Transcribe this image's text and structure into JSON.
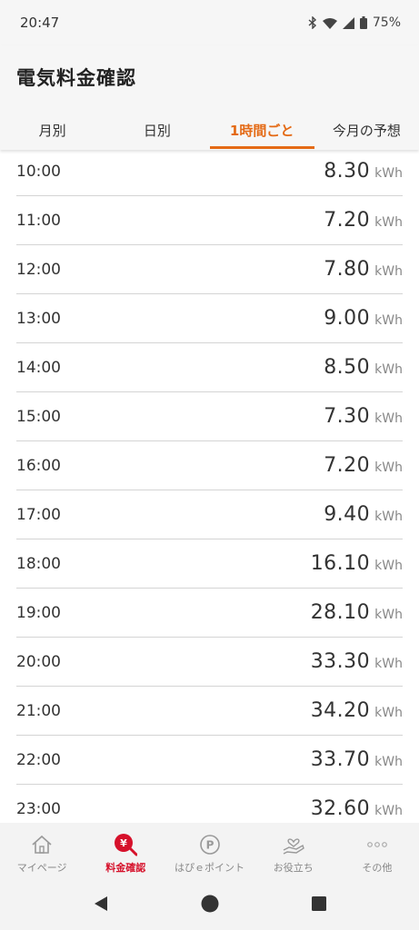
{
  "status_bar": {
    "time": "20:47",
    "battery": "75%",
    "icons": [
      "bluetooth-icon",
      "wifi-icon",
      "signal-icon",
      "battery-icon"
    ]
  },
  "header": {
    "title": "電気料金確認"
  },
  "tabs": [
    {
      "label": "月別",
      "active": false
    },
    {
      "label": "日別",
      "active": false
    },
    {
      "label": "1時間ごと",
      "active": true
    },
    {
      "label": "今月の予想",
      "active": false
    }
  ],
  "usage": {
    "unit": "kWh",
    "rows": [
      {
        "hour": "10:00",
        "value": "8.30"
      },
      {
        "hour": "11:00",
        "value": "7.20"
      },
      {
        "hour": "12:00",
        "value": "7.80"
      },
      {
        "hour": "13:00",
        "value": "9.00"
      },
      {
        "hour": "14:00",
        "value": "8.50"
      },
      {
        "hour": "15:00",
        "value": "7.30"
      },
      {
        "hour": "16:00",
        "value": "7.20"
      },
      {
        "hour": "17:00",
        "value": "9.40"
      },
      {
        "hour": "18:00",
        "value": "16.10"
      },
      {
        "hour": "19:00",
        "value": "28.10"
      },
      {
        "hour": "20:00",
        "value": "33.30"
      },
      {
        "hour": "21:00",
        "value": "34.20"
      },
      {
        "hour": "22:00",
        "value": "33.70"
      },
      {
        "hour": "23:00",
        "value": "32.60"
      }
    ]
  },
  "bottom_nav": [
    {
      "label": "マイページ",
      "icon": "home-icon",
      "active": false
    },
    {
      "label": "料金確認",
      "icon": "yen-search-icon",
      "active": true
    },
    {
      "label": "はぴｅポイント",
      "icon": "point-icon",
      "active": false
    },
    {
      "label": "お役立ち",
      "icon": "hand-heart-icon",
      "active": false
    },
    {
      "label": "その他",
      "icon": "more-icon",
      "active": false
    }
  ],
  "colors": {
    "accent": "#e46a15",
    "nav_active": "#d6112b"
  }
}
